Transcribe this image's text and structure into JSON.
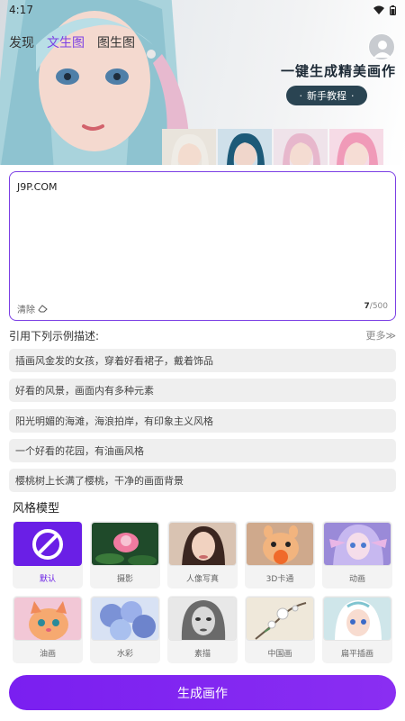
{
  "status_bar": {
    "time": "4:17"
  },
  "header": {
    "tabs": [
      {
        "label": "发现"
      },
      {
        "label": "文生图"
      },
      {
        "label": "图生图"
      }
    ],
    "active_tab": 1
  },
  "banner": {
    "promo_title": "一键生成精美画作",
    "promo_button": "新手教程",
    "promo_button_dot": "·"
  },
  "prompt": {
    "value": "J9P.COM",
    "clear_label": "清除",
    "count_current": "7",
    "count_max": "/500"
  },
  "examples": {
    "heading": "引用下列示例描述:",
    "more_label": "更多≫",
    "items": [
      "插画风金发的女孩，穿着好看裙子，戴着饰品",
      "好看的风景，画面内有多种元素",
      "阳光明媚的海滩，海浪拍岸，有印象主义风格",
      "一个好看的花园，有油画风格",
      "樱桃树上长满了樱桃，干净的画面背景"
    ]
  },
  "styles": {
    "heading": "风格模型",
    "items": [
      {
        "label": "默认"
      },
      {
        "label": "摄影"
      },
      {
        "label": "人像写真"
      },
      {
        "label": "3D卡通"
      },
      {
        "label": "动画"
      },
      {
        "label": "油画"
      },
      {
        "label": "水彩"
      },
      {
        "label": "素描"
      },
      {
        "label": "中国画"
      },
      {
        "label": "扁平插画"
      }
    ],
    "selected_index": 0
  },
  "generate_button": "生成画作",
  "colors": {
    "accent": "#7b3fe4",
    "button": "#7a1ff0",
    "promo_button": "#2a4452"
  }
}
